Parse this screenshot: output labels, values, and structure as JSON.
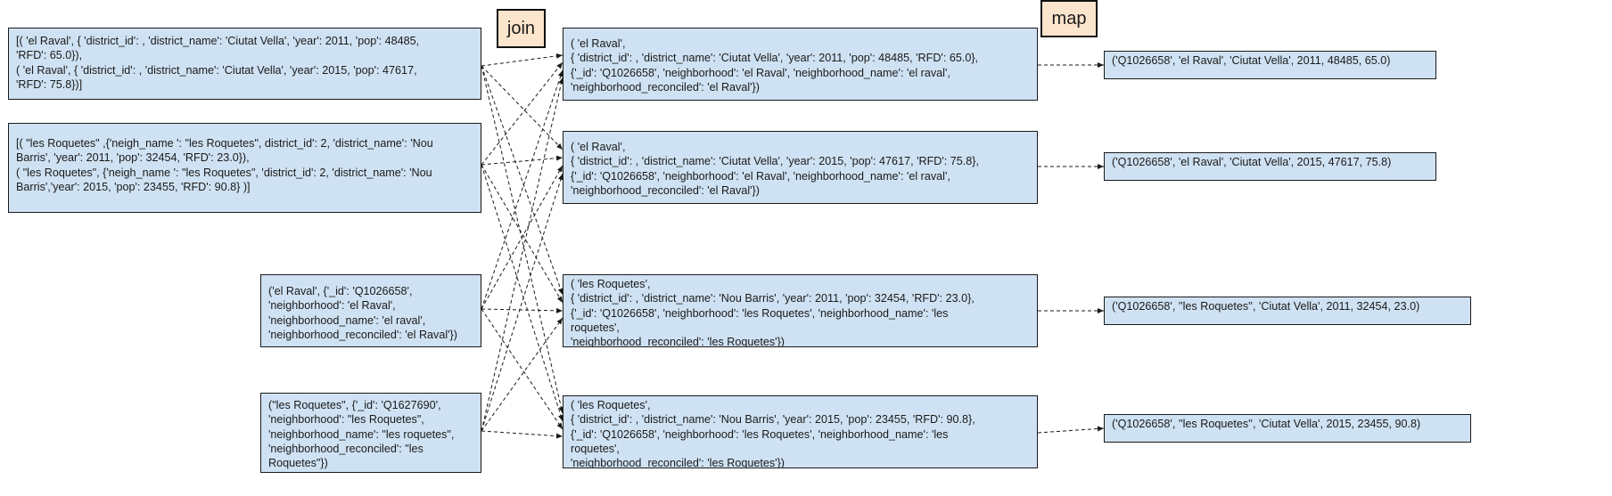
{
  "labels": {
    "join": "join",
    "map": "map"
  },
  "inputs": {
    "raval_stats": [
      "[( 'el Raval', { 'district_id': , 'district_name': 'Ciutat Vella', 'year': 2011, 'pop': 48485,",
      " 'RFD': 65.0}),",
      "( 'el Raval', { 'district_id': , 'district_name': 'Ciutat Vella', 'year': 2015, 'pop': 47617,",
      " 'RFD':  75.8})]"
    ],
    "roquetes_stats": [
      "[( \"les Roquetes\" ,{'neigh_name ': \"les Roquetes\",  district_id': 2, 'district_name': 'Nou",
      "Barris', 'year': 2011, 'pop': 32454, 'RFD': 23.0}),",
      "( \"les Roquetes\", {'neigh_name ': \"les Roquetes\",  'district_id': 2, 'district_name': 'Nou",
      "Barris','year': 2015, 'pop': 23455, 'RFD': 90.8} )]"
    ],
    "raval_lookup": [
      "('el Raval', {'_id': 'Q1026658',",
      " 'neighborhood': 'el Raval',",
      "'neighborhood_name': 'el raval',",
      " 'neighborhood_reconciled': 'el Raval'})"
    ],
    "roquetes_lookup": [
      "(\"les Roquetes\", {'_id': 'Q1627690',",
      " 'neighborhood': \"les Roquetes\",",
      "'neighborhood_name': \"les roquetes\",",
      " 'neighborhood_reconciled': \"les",
      "Roquetes\"})"
    ]
  },
  "joined": [
    [
      "( 'el Raval',",
      "{ 'district_id': , 'district_name': 'Ciutat Vella', 'year': 2011, 'pop': 48485, 'RFD': 65.0},",
      " {'_id': 'Q1026658',  'neighborhood': 'el Raval', 'neighborhood_name': 'el raval',",
      " 'neighborhood_reconciled': 'el Raval'})"
    ],
    [
      "( 'el Raval',",
      "{ 'district_id': , 'district_name': 'Ciutat Vella', 'year': 2015, 'pop': 47617, 'RFD': 75.8},",
      " {'_id': 'Q1026658',  'neighborhood': 'el Raval', 'neighborhood_name': 'el raval',",
      " 'neighborhood_reconciled': 'el Raval'})"
    ],
    [
      "( 'les Roquetes',",
      "{ 'district_id': , 'district_name': 'Nou Barris', 'year': 2011, 'pop': 32454, 'RFD': 23.0},",
      " {'_id': 'Q1026658',  'neighborhood': 'les Roquetes', 'neighborhood_name': 'les",
      "roquetes',",
      " 'neighborhood_reconciled': 'les Roquetes'})"
    ],
    [
      "( 'les Roquetes',",
      "{ 'district_id': , 'district_name': 'Nou Barris', 'year': 2015, 'pop': 23455, 'RFD': 90.8},",
      " {'_id': 'Q1026658',  'neighborhood': 'les Roquetes', 'neighborhood_name': 'les",
      "roquetes',",
      " 'neighborhood_reconciled': 'les Roquetes'})"
    ]
  ],
  "mapped": [
    "('Q1026658',  'el Raval',  'Ciutat Vella', 2011, 48485, 65.0)",
    "('Q1026658',  'el Raval',  'Ciutat Vella', 2015, 47617,  75.8)",
    "('Q1026658',  ''les Roquetes'',  'Ciutat Vella', 2011, 32454, 23.0)",
    "('Q1026658',  ''les Roquetes'',  'Ciutat Vella', 2015, 23455, 90.8)"
  ]
}
